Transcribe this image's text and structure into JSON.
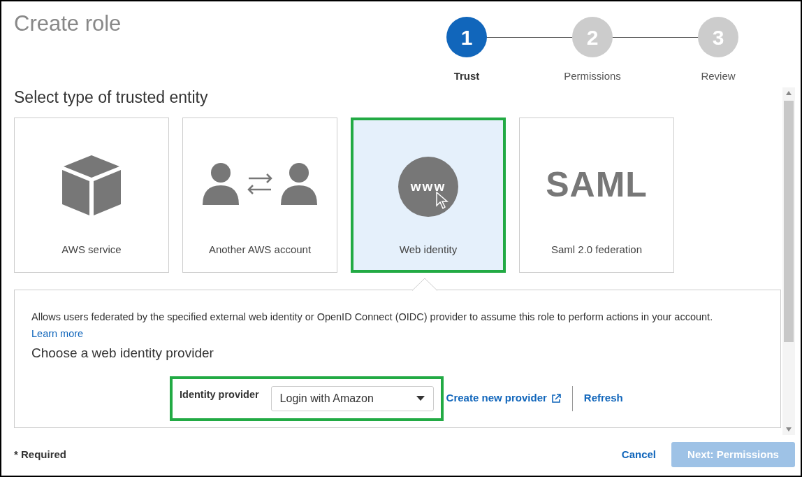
{
  "title": "Create role",
  "steps": [
    {
      "number": "1",
      "label": "Trust",
      "selected": true
    },
    {
      "number": "2",
      "label": "Permissions",
      "selected": false
    },
    {
      "number": "3",
      "label": "Review",
      "selected": false
    }
  ],
  "section_title": "Select type of trusted entity",
  "entity_cards": [
    {
      "kind": "box",
      "label": "AWS service",
      "selected": false
    },
    {
      "kind": "accounts",
      "label": "Another AWS account",
      "selected": false
    },
    {
      "kind": "web",
      "icon_text": "www",
      "label": "Web identity",
      "selected": true
    },
    {
      "kind": "logo",
      "icon_text": "SAML",
      "label": "Saml 2.0 federation",
      "selected": false
    }
  ],
  "description": "Allows users federated by the specified external web identity or OpenID Connect (OIDC) provider to assume this role to perform actions in your account.",
  "learn_more": "Learn more",
  "provider_heading": "Choose a web identity provider",
  "provider_field": {
    "label": "Identity provider",
    "value": "Login with Amazon",
    "highlighted": true
  },
  "create_provider": "Create new provider",
  "refresh": "Refresh",
  "required_note": "* Required",
  "cancel": "Cancel",
  "next": {
    "label": "Next: Permissions",
    "disabled": true
  }
}
